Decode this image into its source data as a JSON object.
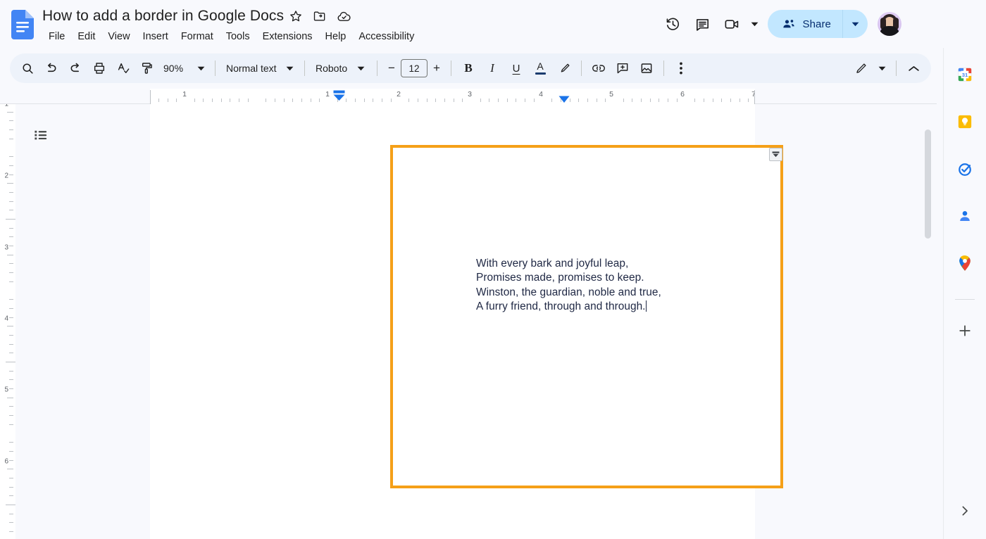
{
  "app": {
    "product": "Google Docs",
    "logo_icon": "google-docs-logo-icon"
  },
  "header": {
    "doc_title": "How to add a border in Google Docs",
    "title_actions": [
      {
        "name": "star-icon",
        "tooltip": "Star"
      },
      {
        "name": "move-to-folder-icon",
        "tooltip": "Move"
      },
      {
        "name": "cloud-saved-icon",
        "tooltip": "See document status"
      }
    ],
    "menus": [
      {
        "label": "File"
      },
      {
        "label": "Edit"
      },
      {
        "label": "View"
      },
      {
        "label": "Insert"
      },
      {
        "label": "Format"
      },
      {
        "label": "Tools"
      },
      {
        "label": "Extensions"
      },
      {
        "label": "Help"
      },
      {
        "label": "Accessibility"
      }
    ],
    "right_actions": [
      {
        "name": "version-history-icon",
        "tooltip": "Last edit"
      },
      {
        "name": "comment-history-icon",
        "tooltip": "Open comment history"
      },
      {
        "name": "meet-camera-icon",
        "tooltip": "Join a call"
      }
    ],
    "share_label": "Share",
    "share_icon": "share-people-icon",
    "share_caret_icon": "chevron-down-icon",
    "avatar_name": "account-avatar",
    "colors": {
      "share_bg": "#C2E7FF",
      "share_text": "#062E6F"
    }
  },
  "toolbar": {
    "bg_color": "#EDF2FA",
    "items": [
      {
        "name": "search-icon",
        "tooltip": "Search the menus"
      },
      {
        "name": "undo-icon",
        "tooltip": "Undo"
      },
      {
        "name": "redo-icon",
        "tooltip": "Redo"
      },
      {
        "name": "print-icon",
        "tooltip": "Print"
      },
      {
        "name": "spellcheck-icon",
        "tooltip": "Spelling and grammar check"
      },
      {
        "name": "paint-format-icon",
        "tooltip": "Paint format"
      }
    ],
    "zoom_value": "90%",
    "zoom_caret_icon": "chevron-down-icon",
    "paragraph_style": "Normal text",
    "paragraph_style_caret_icon": "chevron-down-icon",
    "font_family": "Roboto",
    "font_caret_icon": "chevron-down-icon",
    "font_decrease_label": "−",
    "font_size": "12",
    "font_increase_label": "+",
    "bold_label": "B",
    "italic_label": "I",
    "underline_label": "U",
    "text_color_label": "A",
    "highlight_icon": "highlight-pen-icon",
    "link_icon": "insert-link-icon",
    "comment_icon": "add-comment-icon",
    "image_icon": "insert-image-icon",
    "more_icon": "more-options-icon",
    "editing_mode_icon": "editing-pencil-icon",
    "editing_mode_caret_icon": "chevron-down-icon",
    "collapse_icon": "chevron-up-icon"
  },
  "ruler": {
    "horizontal_numbers": [
      "1",
      "1",
      "2",
      "3",
      "4",
      "5",
      "6",
      "7"
    ],
    "vertical_numbers": [
      "1",
      "2",
      "3",
      "4",
      "5",
      "6"
    ],
    "left_indent_marker": "left-indent-marker",
    "right_indent_marker": "right-indent-marker"
  },
  "canvas": {
    "outline_button_icon": "show-document-outline-icon",
    "scrollbar_name": "vertical-scrollbar"
  },
  "document": {
    "border_color": "#F5A018",
    "border_width_px": 4,
    "cell_handle_icon": "table-cell-options-icon",
    "body_lines": [
      "With every bark and joyful leap,",
      "Promises made, promises to keep.",
      "Winston, the guardian, noble and true,",
      "A furry friend, through and through."
    ],
    "text_color": "#202945"
  },
  "side_panel": {
    "apps": [
      {
        "name": "google-calendar-icon",
        "label": "Calendar"
      },
      {
        "name": "google-keep-icon",
        "label": "Keep"
      },
      {
        "name": "google-tasks-icon",
        "label": "Tasks"
      },
      {
        "name": "google-contacts-icon",
        "label": "Contacts"
      },
      {
        "name": "google-maps-icon",
        "label": "Maps"
      }
    ],
    "add_label": "+",
    "expand_icon": "chevron-right-icon"
  }
}
